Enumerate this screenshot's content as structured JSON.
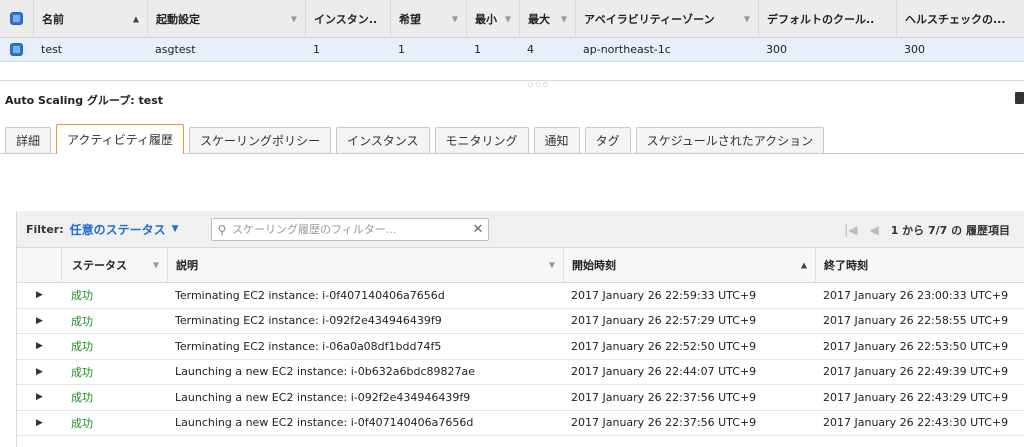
{
  "asg": {
    "columns": [
      "名前",
      "起動設定",
      "インスタン..",
      "希望",
      "最小",
      "最大",
      "アベイラビリティーゾーン",
      "デフォルトのクール..",
      "ヘルスチェックの..."
    ],
    "row": {
      "name": "test",
      "launch_config": "asgtest",
      "instances": "1",
      "desired": "1",
      "min": "1",
      "max": "4",
      "az": "ap-northeast-1c",
      "cooldown": "300",
      "health_check": "300"
    }
  },
  "detail": {
    "title": "Auto Scaling グループ: test"
  },
  "tabs": [
    "詳細",
    "アクティビティ履歴",
    "スケーリングポリシー",
    "インスタンス",
    "モニタリング",
    "通知",
    "タグ",
    "スケジュールされたアクション"
  ],
  "history": {
    "filter_label": "Filter:",
    "filter_value": "任意のステータス",
    "search_placeholder": "スケーリング履歴のフィルター...",
    "pager_text": "1 から 7/7 の 履歴項目",
    "columns": [
      "ステータス",
      "説明",
      "開始時刻",
      "終了時刻"
    ],
    "rows": [
      {
        "status": "成功",
        "desc": "Terminating EC2 instance: i-0f407140406a7656d",
        "start": "2017 January 26 22:59:33 UTC+9",
        "end": "2017 January 26 23:00:33 UTC+9"
      },
      {
        "status": "成功",
        "desc": "Terminating EC2 instance: i-092f2e434946439f9",
        "start": "2017 January 26 22:57:29 UTC+9",
        "end": "2017 January 26 22:58:55 UTC+9"
      },
      {
        "status": "成功",
        "desc": "Terminating EC2 instance: i-06a0a08df1bdd74f5",
        "start": "2017 January 26 22:52:50 UTC+9",
        "end": "2017 January 26 22:53:50 UTC+9"
      },
      {
        "status": "成功",
        "desc": "Launching a new EC2 instance: i-0b632a6bdc89827ae",
        "start": "2017 January 26 22:44:07 UTC+9",
        "end": "2017 January 26 22:49:39 UTC+9"
      },
      {
        "status": "成功",
        "desc": "Launching a new EC2 instance: i-092f2e434946439f9",
        "start": "2017 January 26 22:37:56 UTC+9",
        "end": "2017 January 26 22:43:29 UTC+9"
      },
      {
        "status": "成功",
        "desc": "Launching a new EC2 instance: i-0f407140406a7656d",
        "start": "2017 January 26 22:37:56 UTC+9",
        "end": "2017 January 26 22:43:30 UTC+9"
      }
    ]
  },
  "colors": {
    "accent": "#1f6fcf",
    "success": "#1d8f1d",
    "active_tab_border": "#e89a2c",
    "selected_row": "#e6effa"
  }
}
